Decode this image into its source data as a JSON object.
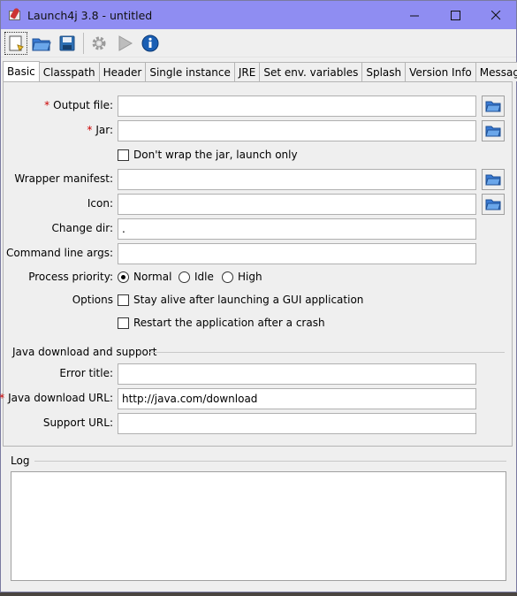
{
  "window": {
    "title": "Launch4j 3.8 - untitled"
  },
  "win_controls": {
    "minimize": "—",
    "maximize": "☐",
    "close": "✕"
  },
  "toolbar": {
    "icons": [
      "new-document-icon",
      "open-folder-icon",
      "save-icon",
      "build-gear-icon",
      "run-play-icon",
      "about-info-icon"
    ],
    "colors": {
      "folder": "#3a7bd5",
      "save": "#2d6fb3",
      "info": "#1a5fb4",
      "gear": "#9a9a9a",
      "play": "#a8a8a8"
    }
  },
  "tabs": [
    "Basic",
    "Classpath",
    "Header",
    "Single instance",
    "JRE",
    "Set env. variables",
    "Splash",
    "Version Info",
    "Messages"
  ],
  "basic": {
    "required_mark": "*",
    "output_file": {
      "label": "Output file:",
      "value": ""
    },
    "jar": {
      "label": "Jar:",
      "value": ""
    },
    "dont_wrap": {
      "label": "Don't wrap the jar, launch only",
      "checked": false
    },
    "wrapper_manifest": {
      "label": "Wrapper manifest:",
      "value": ""
    },
    "icon": {
      "label": "Icon:",
      "value": ""
    },
    "change_dir": {
      "label": "Change dir:",
      "value": "."
    },
    "cmd_args": {
      "label": "Command line args:",
      "value": ""
    },
    "priority": {
      "label": "Process priority:",
      "normal": "Normal",
      "idle": "Idle",
      "high": "High",
      "selected": "Normal"
    },
    "options": {
      "label": "Options",
      "stay_alive": "Stay alive after launching a GUI application",
      "restart": "Restart the application after a crash"
    },
    "java_section": "Java download and support",
    "error_title": {
      "label": "Error title:",
      "value": ""
    },
    "java_url": {
      "label": "Java download URL:",
      "value": "http://java.com/download"
    },
    "support_url": {
      "label": "Support URL:",
      "value": ""
    }
  },
  "log": {
    "label": "Log",
    "content": ""
  }
}
